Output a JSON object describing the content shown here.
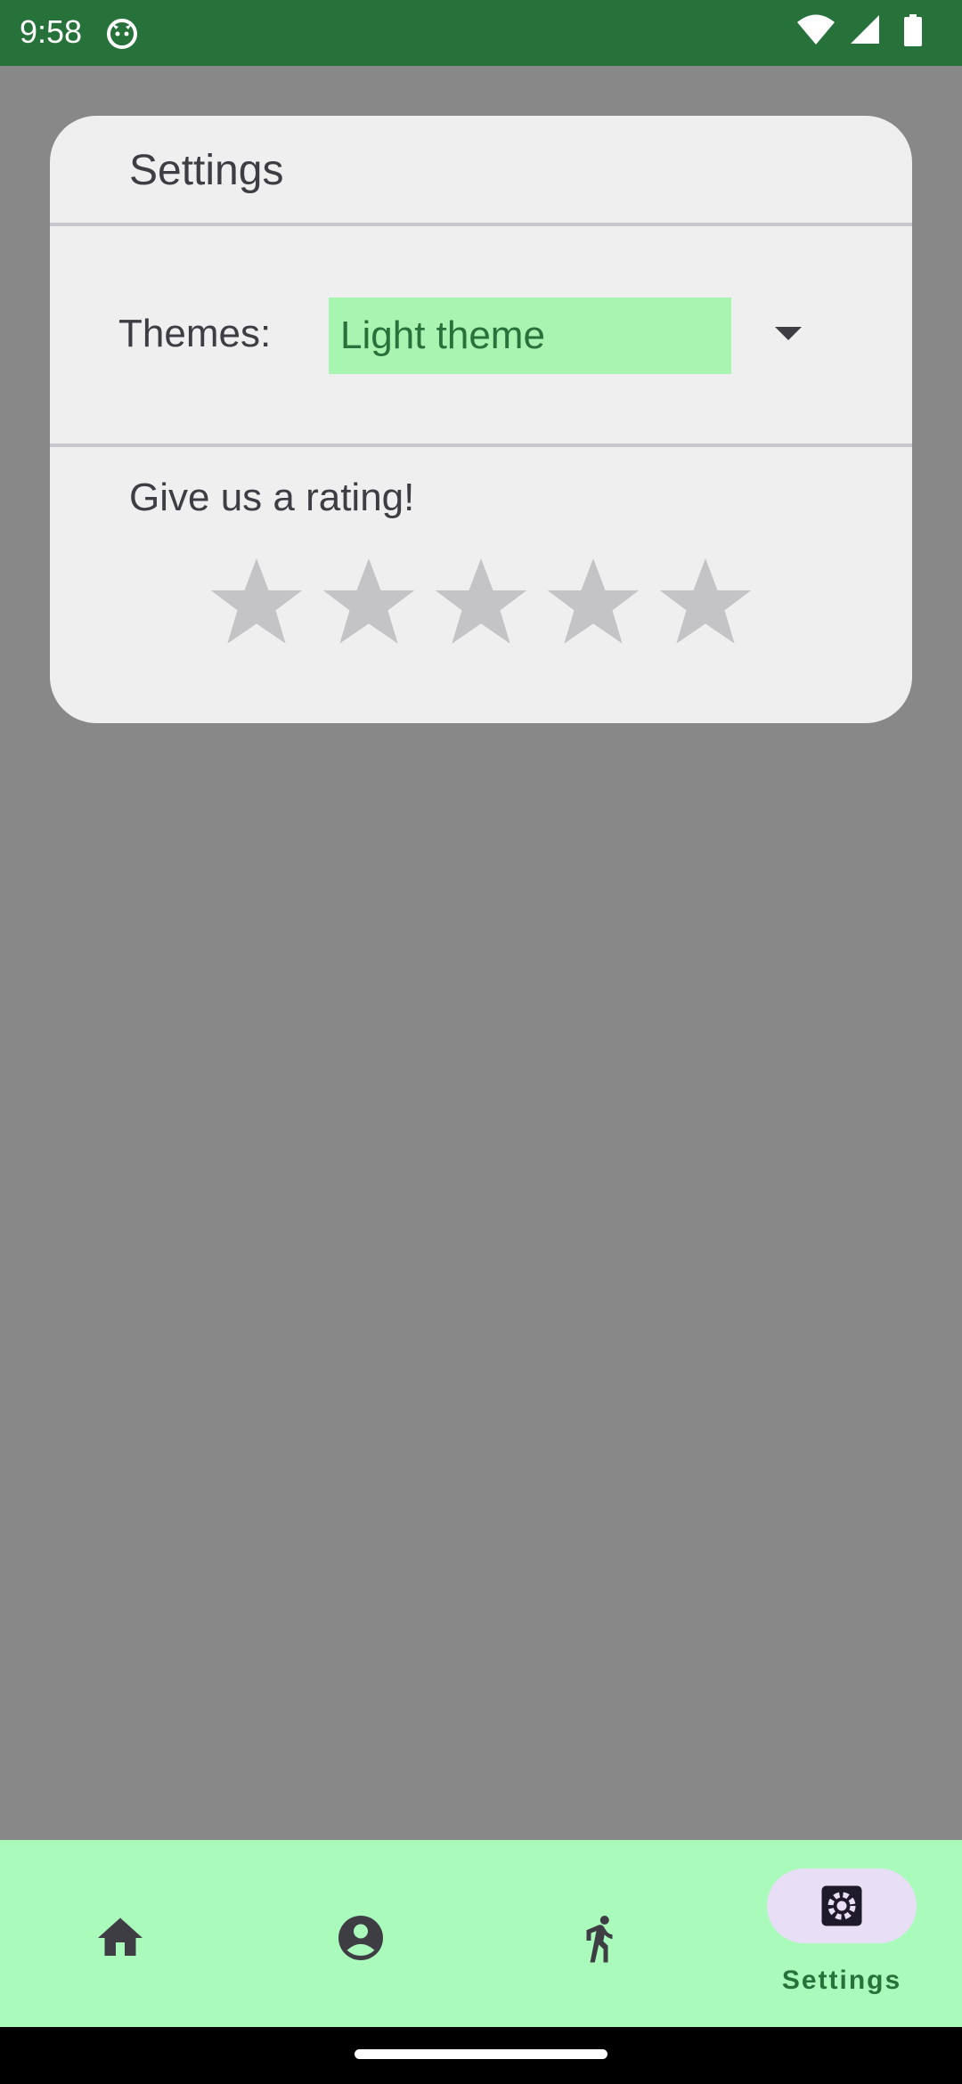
{
  "status_bar": {
    "time": "9:58",
    "app_icon": "cat-notification-icon",
    "wifi_icon": "wifi-icon",
    "signal_icon": "cell-signal-icon",
    "battery_icon": "battery-icon"
  },
  "dialog": {
    "title": "Settings",
    "themes_label": "Themes:",
    "theme_selected": "Light theme",
    "dropdown_icon": "dropdown-arrow-icon",
    "rating_label": "Give us a rating!",
    "rating": {
      "value": 0,
      "max": 5
    },
    "star_icon": "star-icon"
  },
  "bottom_nav": {
    "items": [
      {
        "id": "home",
        "icon": "home-icon",
        "label": ""
      },
      {
        "id": "profile",
        "icon": "account-circle-icon",
        "label": ""
      },
      {
        "id": "activity",
        "icon": "walking-icon",
        "label": ""
      },
      {
        "id": "settings",
        "icon": "settings-icon",
        "label": "Settings",
        "selected": true
      }
    ]
  },
  "colors": {
    "status_bar": "#27713a",
    "scrim": "#888888",
    "dialog_bg": "#efefef",
    "accent_green": "#27713a",
    "select_bg": "#a8f4b1",
    "nav_bg": "#aafabc",
    "nav_indicator": "#e8dff6",
    "star_empty": "#c4c4c6"
  }
}
